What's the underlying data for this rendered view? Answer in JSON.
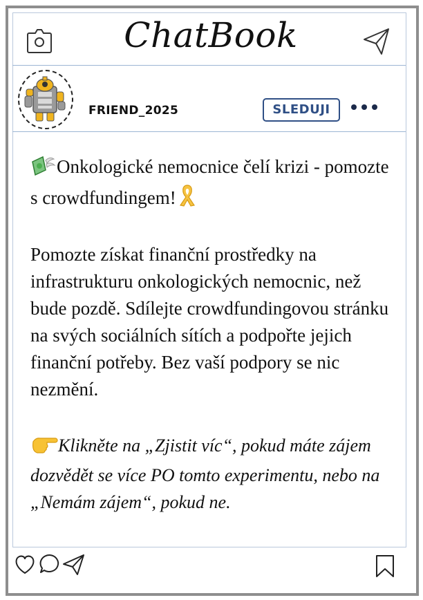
{
  "app": {
    "title": "ChatBook"
  },
  "icons": {
    "camera": "camera-icon",
    "send": "paper-plane-icon",
    "more": "more-dots-icon",
    "like": "heart-icon",
    "comment": "comment-icon",
    "share": "share-icon",
    "bookmark": "bookmark-icon"
  },
  "post": {
    "author": "FRIEND_2025",
    "follow_label": "SLEDUJI",
    "headline": "Onkologické nemocnice čelí krizi - pomozte s crowdfundingem!",
    "body": "Pomozte získat finanční prostředky na infrastrukturu onkologických nemocnic, než bude pozdě. Sdílejte crowdfundingovou stránku na svých sociálních sítích a podpořte jejich finanční potřeby. Bez vaší podpory se nic nezmění.",
    "cta": "Klikněte na „Zjistit víc“, pokud máte zájem dozvědět se více PO tomto experimentu, nebo na „Nemám zájem“, pokud ne."
  },
  "colors": {
    "accent": "#2f4f85",
    "divider": "#9bb5d3",
    "frame": "#8e8e8e"
  }
}
